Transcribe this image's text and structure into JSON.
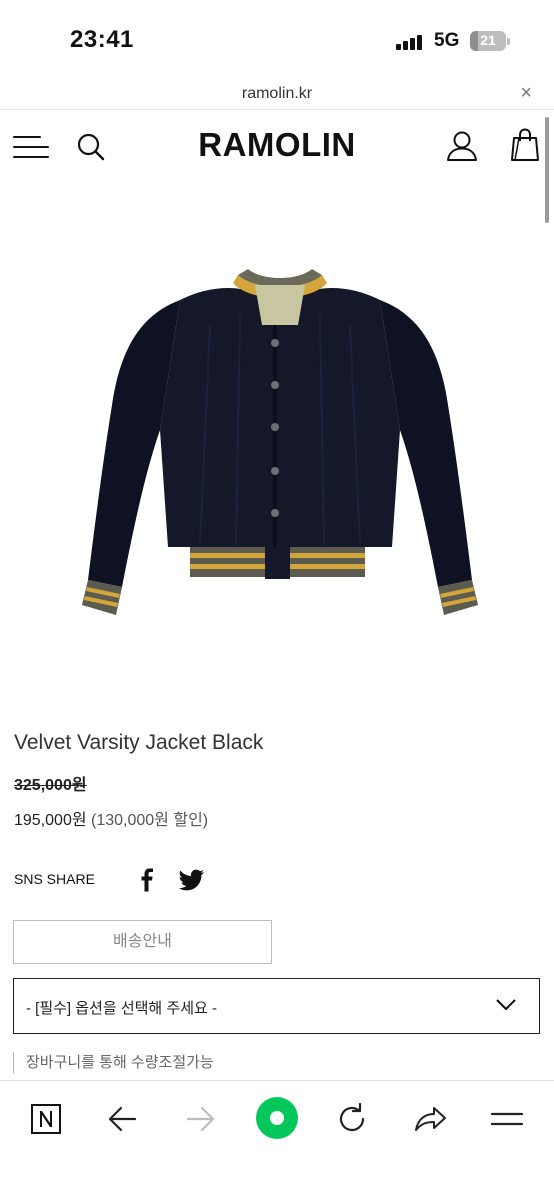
{
  "status_bar": {
    "time": "23:41",
    "network": "5G",
    "battery": "21",
    "battery_fraction": 0.21
  },
  "browser": {
    "url": "ramolin.kr",
    "close_label": "×"
  },
  "header": {
    "brand": "RAMOLIN",
    "icons": [
      "menu-icon",
      "search-icon",
      "user-icon",
      "shopping-bag-icon"
    ]
  },
  "product": {
    "image_alt": "velvet varsity jacket",
    "name": "Velvet Varsity Jacket Black",
    "original_price": "325,000원",
    "sale_price": "195,000원",
    "discount": "(130,000원 할인)"
  },
  "sns": {
    "label": "SNS SHARE",
    "icons": [
      "facebook-icon",
      "twitter-icon"
    ]
  },
  "shipping_button": "배송안내",
  "option_select": {
    "placeholder": "- [필수] 옵션을 선택해 주세요 -"
  },
  "notice": "장바구니를 통해 수량조절가능",
  "toolbar": {
    "icons": [
      "naver-n-icon",
      "back-arrow-icon",
      "forward-arrow-icon",
      "home-icon",
      "reload-icon",
      "share-icon",
      "more-menu-icon"
    ],
    "accent_color": "#03c75a"
  }
}
